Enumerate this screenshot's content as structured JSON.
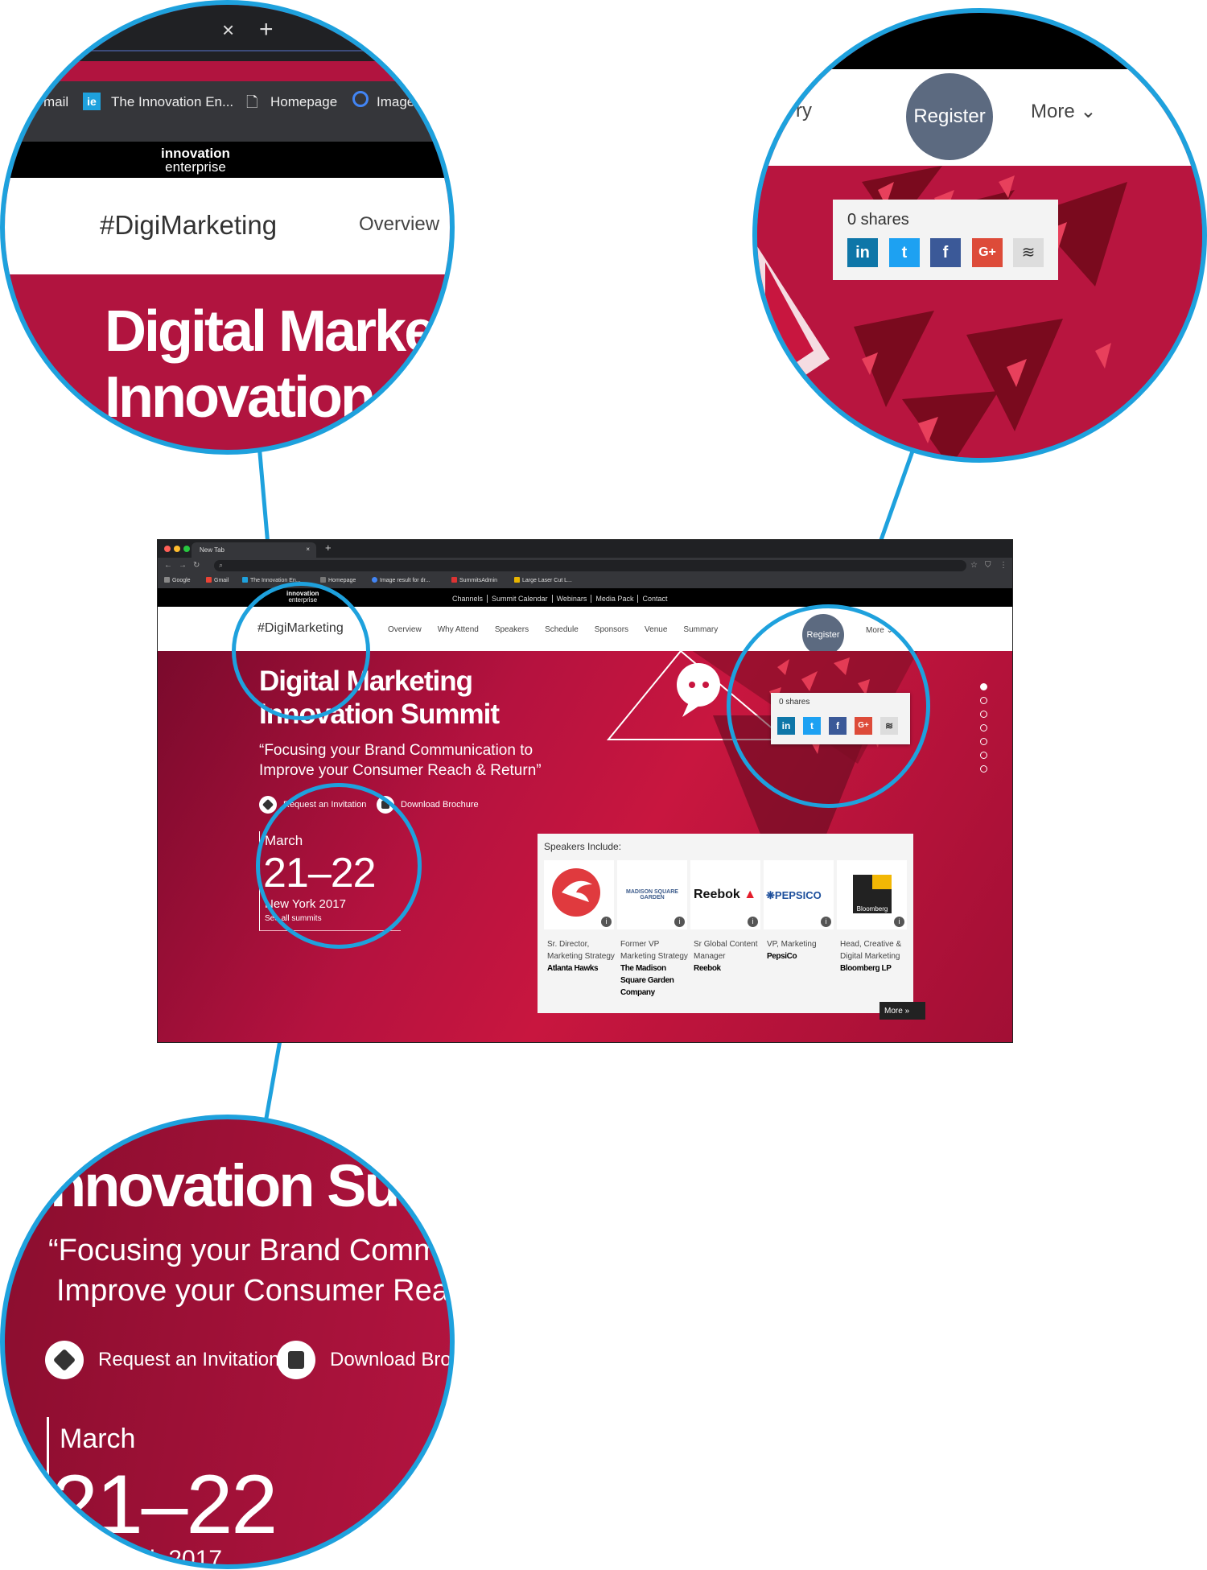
{
  "browser": {
    "tab_title": "New Tab",
    "tab_close": "×",
    "new_tab": "+",
    "bookmarks": [
      "Google",
      "Gmail",
      "The Innovation En...",
      "Homepage",
      "Image result for dr...",
      "SummitsAdmin",
      "Large Laser Cut L..."
    ]
  },
  "site": {
    "logo_line1": "innovation",
    "logo_line2": "enterprise",
    "top_links": [
      "Channels",
      "Summit Calendar",
      "Webinars",
      "Media Pack",
      "Contact"
    ],
    "brand": "#DigiMarketing",
    "nav": [
      "Overview",
      "Why Attend",
      "Speakers",
      "Schedule",
      "Sponsors",
      "Venue",
      "Summary"
    ],
    "register": "Register",
    "more": "More ⌄"
  },
  "hero": {
    "title_line1": "Digital Marketing",
    "title_line2": "Innovation Summit",
    "quote_line1": "“Focusing your Brand Communication to",
    "quote_line2": "Improve your Consumer Reach & Return”",
    "cta_invite": "Request an Invitation",
    "cta_brochure": "Download Brochure",
    "date_month": "March",
    "date_days": "21–22",
    "date_location": "New York 2017",
    "see_all": "See all summits"
  },
  "share": {
    "count": "0 shares",
    "buttons": [
      {
        "label": "in",
        "color": "#0e76a8"
      },
      {
        "label": "t",
        "color": "#1da1f2"
      },
      {
        "label": "f",
        "color": "#3b5998"
      },
      {
        "label": "G+",
        "color": "#dd4b39"
      },
      {
        "label": "≋",
        "color": "#dddddd"
      }
    ]
  },
  "speakers": {
    "title": "Speakers Include:",
    "more": "More",
    "items": [
      {
        "logo": "",
        "role": "Sr. Director, Marketing Strategy",
        "company": "Atlanta Hawks"
      },
      {
        "logo": "MADISON SQUARE GARDEN",
        "role": "Former VP Marketing Strategy",
        "company": "The Madison Square Garden Company"
      },
      {
        "logo": "Reebok",
        "role": "Sr Global Content Manager",
        "company": "Reebok"
      },
      {
        "logo": "PEPSICO",
        "role": "VP, Marketing",
        "company": "PepsiCo"
      },
      {
        "logo": "Bloomberg",
        "role": "Head, Creative & Digital Marketing",
        "company": "Bloomberg LP"
      }
    ]
  },
  "zoom_brand": {
    "tab_close": "×",
    "new_tab": "+",
    "bm1": "mail",
    "bm2": "The Innovation En...",
    "bm3": "Homepage",
    "bm4": "Image",
    "logo_line1": "innovation",
    "logo_line2": "enterprise",
    "brand": "#DigiMarketing",
    "overview": "Overview",
    "title_line1": "Digital Marke",
    "title_line2": "Innovation S"
  },
  "zoom_share": {
    "menu_frag": "ry",
    "register": "Register",
    "more": "More ⌄",
    "count": "0 shares"
  },
  "zoom_cta": {
    "title_frag": "nnovation Su",
    "quote_line1": "“Focusing your Brand Comm",
    "quote_line2": "Improve your Consumer Rea",
    "cta_invite": "Request an Invitation",
    "cta_brochure": "Download Broc",
    "date_month": "March",
    "date_days": "21–22",
    "date_location": "k 2017"
  },
  "colors": {
    "accent": "#1ea1dd",
    "hero": "#c8163f",
    "register": "#5c6a80"
  }
}
